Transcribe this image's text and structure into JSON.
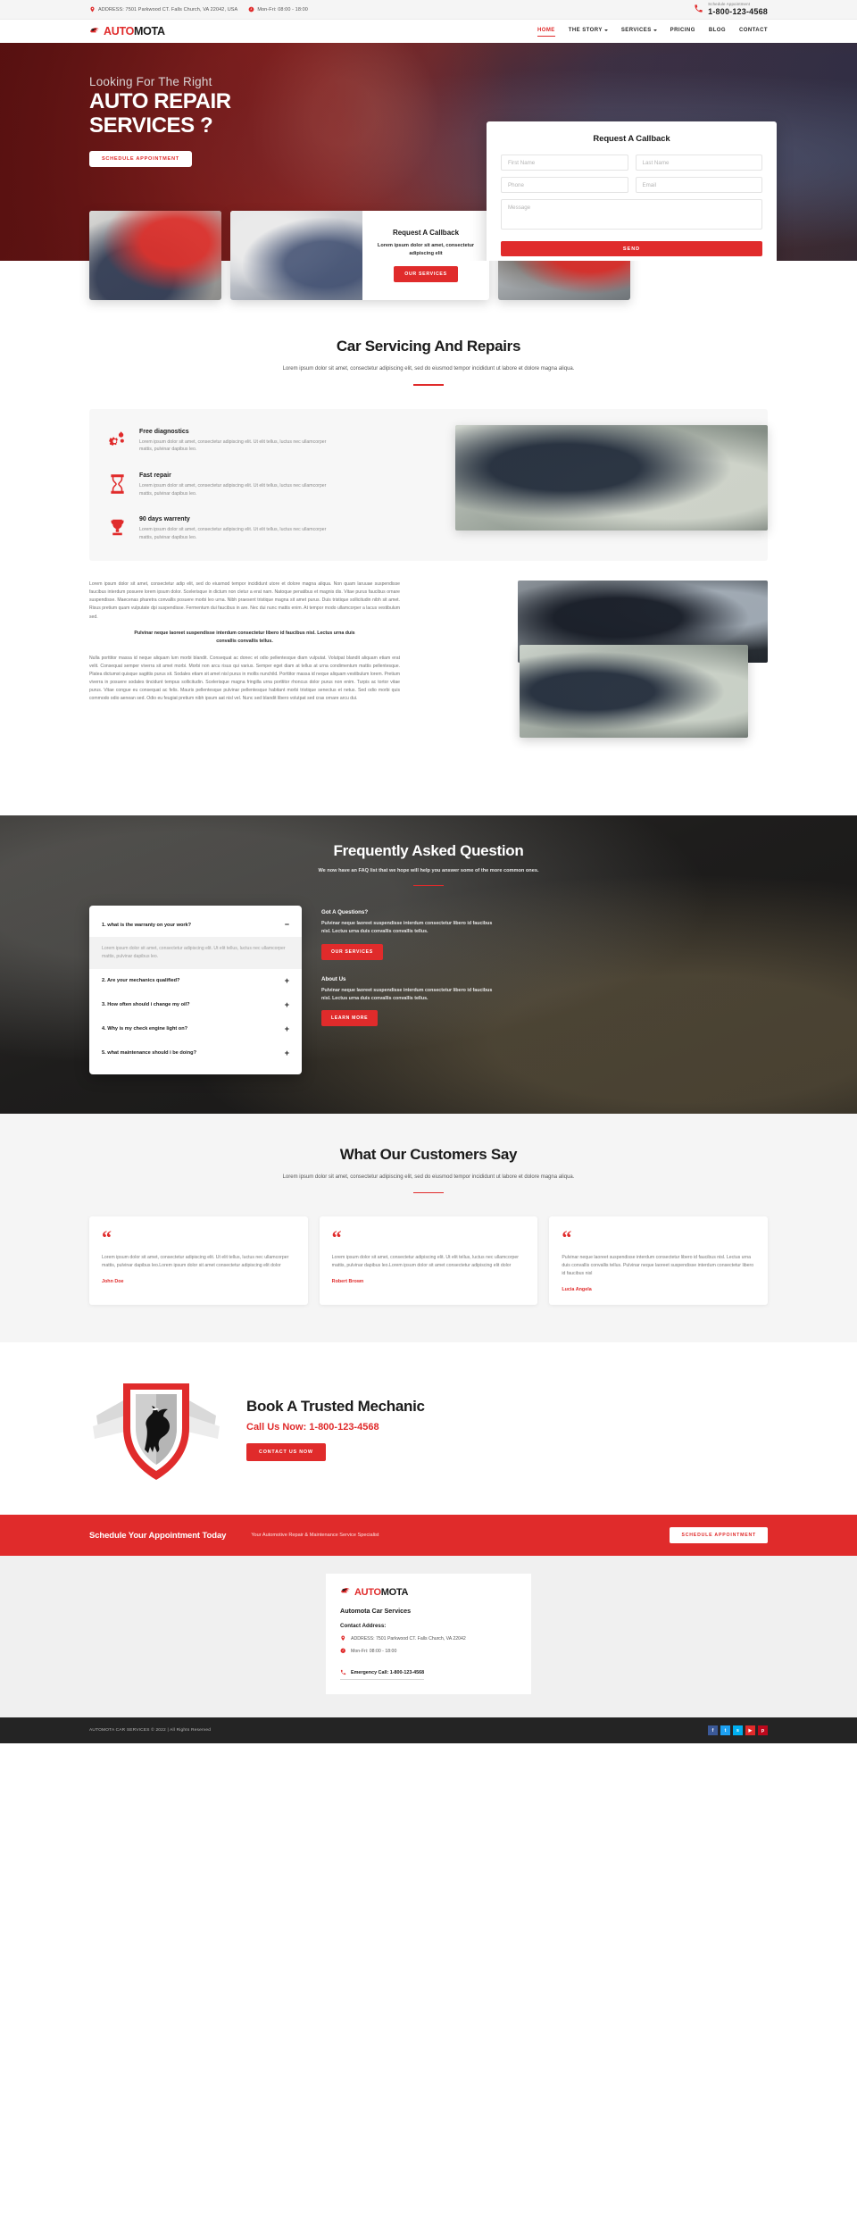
{
  "topbar": {
    "address": "ADDRESS: 7501 Parkwood CT. Falls Church, VA 22042, USA",
    "hours": "Mon-Fri: 08:00 - 18:00",
    "schedule_label": "Schedule Appointment",
    "phone": "1-800-123-4568",
    "pin_icon": "map-pin-icon",
    "clock_icon": "clock-icon",
    "phone_icon": "phone-icon"
  },
  "brand": {
    "first": "AUTO",
    "second": "MOTA",
    "mark_icon": "horse-logo-icon"
  },
  "nav": {
    "items": [
      {
        "label": "HOME",
        "active": true,
        "caret": false
      },
      {
        "label": "THE STORY",
        "active": false,
        "caret": true
      },
      {
        "label": "SERVICES",
        "active": false,
        "caret": true
      },
      {
        "label": "PRICING",
        "active": false,
        "caret": false
      },
      {
        "label": "BLOG",
        "active": false,
        "caret": false
      },
      {
        "label": "CONTACT",
        "active": false,
        "caret": false
      }
    ]
  },
  "hero": {
    "subtitle": "Looking For The Right",
    "title_line1": "AUTO REPAIR",
    "title_line2": "SERVICES ?",
    "button": "SCHEDULE APPOINTMENT"
  },
  "callback_form": {
    "title": "Request A Callback",
    "first_name_placeholder": "First Name",
    "last_name_placeholder": "Last Name",
    "phone_placeholder": "Phone",
    "email_placeholder": "Email",
    "message_placeholder": "Message",
    "first_name_value": "",
    "last_name_value": "",
    "phone_value": "",
    "email_value": "",
    "message_value": "",
    "send_label": "SEND"
  },
  "strip": {
    "card_title": "Request A Callback",
    "card_text": "Lorem ipsum dolor sit amet, consectetur adipiscing elit",
    "card_button": "OUR SERVICES"
  },
  "servicing": {
    "title": "Car Servicing And Repairs",
    "subtitle": "Lorem ipsum dolor sit amet, consectetur adipiscing elit, sed do eiusmod tempor incididunt ut labore et dolore magna aliqua.",
    "features": [
      {
        "icon": "gears-icon",
        "title": "Free diagnostics",
        "text": "Lorem ipsum dolor sit amet, consectetur adipiscing elit. Ut elit tellus, luctus nec ullamcorper mattis, pulvinar dapibus leo."
      },
      {
        "icon": "hourglass-icon",
        "title": "Fast repair",
        "text": "Lorem ipsum dolor sit amet, consectetur adipiscing elit. Ut elit tellus, luctus nec ullamcorper mattis, pulvinar dapibus leo."
      },
      {
        "icon": "trophy-icon",
        "title": "90 days warrenty",
        "text": "Lorem ipsum dolor sit amet, consectetur adipiscing elit. Ut elit tellus, luctus nec ullamcorper mattis, pulvinar dapibus leo."
      }
    ]
  },
  "article": {
    "p1": "Lorem ipsum dolor sit amet, consectetur adip elit, sed do eiusmod tempor incididunt utore et dolore magna aliqua. Non quam laruuae suspendisse faucibus interdum posuere lorem ipsum dolor. Scelerisque in dictum non cletur a erat nam. Natoque penatibus et magnis dis. Vitae purus faucibus ornare suspendisse. Maecenas pharetra convallis posuere morbi leo urna. Nibh praesent tristique magna sit amet purus. Duis tristique sollicitudin nibh sit amet. Risus pretium quam vulputate dpi suspendisse. Fermentum dui faucibus in are. Nec dui nunc mattis enim. At tempor modo ullamcorper a lacus vestibulum sed.",
    "quote": "Pulvinar neque laoreet suspendisse interdum consectetur libero id faucibus nisl. Lectus urna duis convallis convallis tellus.",
    "p2": "Nulla porttitor massa id neque aliquam lum morbi blandit. Consequat ac donec et odio pellentesque diam vulputat. Volutpat blandit aliquam etiam erat velit. Consequat semper viverra sit amet morbi. Morbi non arcu risus qui varius. Semper eget diam at tellus at urna condimentum mattis pellentesque. Platea dictumst quisque sagittis purus sit. Sodales etiam sit amet nisl purus in mollis nunchild. Porttitor massa id neque aliquam vestibulum lorem. Pretium viverra in posuere sodales tincidunt tempus sollicitudin. Scelerisque magna fringilla urna porttitor rhoncus dolor purus non enim. Turpis ac tortor vitae purus. Vitae congue eu consequat ac felis. Mauris pellentesque pulvinar pellentesque habitant morbi tristique senectus et netus. Sed odio morbi quis commodo odio aenean sed. Odio eu feugiat pretium nibh ipsum aat nisl vel. Nunc sed blandit libero volutpat sed cras ornare arcu dui."
  },
  "faq": {
    "title": "Frequently Asked Question",
    "subtitle": "We now have an FAQ list that we hope will help you answer some of the more common ones.",
    "items": [
      {
        "q": "1. what is the warranty on your work?",
        "sign": "−",
        "open": true,
        "a": "Lorem ipsum dolor sit amet, consectetur adipiscing elit. Ut elit tellus, luctus nec ullamcorper mattis, pulvinar dapibus leo."
      },
      {
        "q": "2. Are your mechanics qualified?",
        "sign": "+",
        "open": false,
        "a": ""
      },
      {
        "q": "3. How often should i change my oil?",
        "sign": "+",
        "open": false,
        "a": ""
      },
      {
        "q": "4. Why is my check engine light on?",
        "sign": "+",
        "open": false,
        "a": ""
      },
      {
        "q": "5. what maintenance should i be doing?",
        "sign": "+",
        "open": false,
        "a": ""
      }
    ],
    "side": [
      {
        "heading": "Got A Questions?",
        "text": "Pulvinar neque laoreet suspendisse interdum consectetur libero id faucibus nisl. Lectus urna duis convallis convallis tellus.",
        "button": "OUR SERVICES"
      },
      {
        "heading": "About Us",
        "text": "Pulvinar neque laoreet suspendisse interdum consectetur libero id faucibus nisl. Lectus urna duis convallis convallis tellus.",
        "button": "LEARN MORE"
      }
    ]
  },
  "testimonials": {
    "title": "What Our Customers Say",
    "subtitle": "Lorem ipsum dolor sit amet, consectetur adipiscing elit, sed do eiusmod tempor incididunt ut labore et dolore magna aliqua.",
    "cards": [
      {
        "quote_glyph": "“",
        "text": "Lorem ipsum dolor sit amet, consectetur adipiscing elit. Ut elit tellus, luctus nec ullamcorper mattis, pulvinar dapibus leo.Lorem ipsum dolor sit amet consectetur adipiscing elit dolor",
        "name": "John Doe"
      },
      {
        "quote_glyph": "“",
        "text": "Lorem ipsum dolor sit amet, consectetur adipiscing elit. Ut elit tellus, luctus nec ullamcorper mattis, pulvinar dapibus leo.Lorem ipsum dolor sit amet consectetur adipiscing elit dolor",
        "name": "Robert Brown"
      },
      {
        "quote_glyph": "“",
        "text": "Pulvinar neque laoreet suspendisse interdum consectetur libero id faucibus nisl. Lectus urna duis convallis convallis tellus. Pulvinar neque laoreet suspendisse interdum consectetur libero id faucibus nisl",
        "name": "Lucia Angela"
      }
    ]
  },
  "book": {
    "heading": "Book A Trusted Mechanic",
    "call": "Call Us Now: 1-800-123-4568",
    "button": "CONTACT US NOW",
    "shield_icon": "horse-shield-badge-icon"
  },
  "cta": {
    "heading": "Schedule Your Appointment Today",
    "sub": "Your Automotive Repair & Maintenance Service Specialist",
    "button": "SCHEDULE APPOINTMENT"
  },
  "footer": {
    "company": "Automota Car Services",
    "contact_heading": "Contact Address:",
    "address": "ADDRESS: 7501 Parkwood CT. Falls Church, VA 22042",
    "hours": "Mon-Fri: 08:00 - 18:00",
    "emergency": "Emergency Call: 1-800-123-4568"
  },
  "copyright": {
    "text": "AUTOMOTA CAR SERVICES © 2022 | All Rights Reserved",
    "socials": [
      {
        "name": "facebook-icon",
        "glyph": "f",
        "color": "#3b5998"
      },
      {
        "name": "twitter-icon",
        "glyph": "t",
        "color": "#1da1f2"
      },
      {
        "name": "skype-icon",
        "glyph": "s",
        "color": "#00aff0"
      },
      {
        "name": "youtube-icon",
        "glyph": "▶",
        "color": "#e02b2b"
      },
      {
        "name": "pinterest-icon",
        "glyph": "p",
        "color": "#bd081c"
      }
    ]
  },
  "colors": {
    "accent": "#e02b2b",
    "dark": "#242424",
    "light": "#f5f5f5"
  }
}
